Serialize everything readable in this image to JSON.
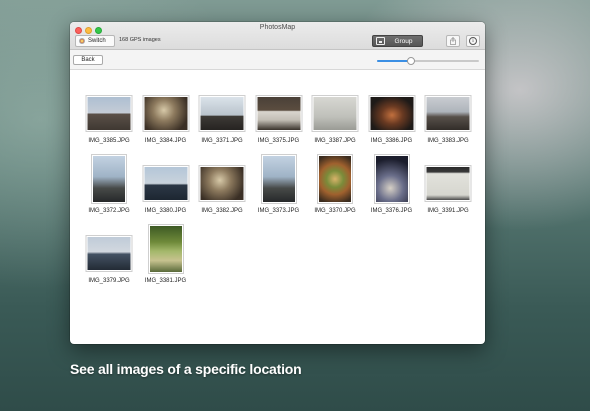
{
  "window": {
    "title": "PhotosMap",
    "switch_label": "Switch",
    "count_label": "168 GPS images",
    "group_label": "Group",
    "back_label": "Back",
    "share_icon": "share-icon",
    "info_icon": "info-icon",
    "info_glyph": "i",
    "zoom_fraction": 0.33
  },
  "photos": [
    {
      "name": "IMG_3385.JPG",
      "style": "p-skyline",
      "orientation": "landscape"
    },
    {
      "name": "IMG_3384.JPG",
      "style": "p-indoor",
      "orientation": "landscape"
    },
    {
      "name": "IMG_3371.JPG",
      "style": "p-tower",
      "orientation": "landscape"
    },
    {
      "name": "IMG_3375.JPG",
      "style": "p-desk",
      "orientation": "landscape"
    },
    {
      "name": "IMG_3387.JPG",
      "style": "p-screen",
      "orientation": "landscape"
    },
    {
      "name": "IMG_3386.JPG",
      "style": "p-night",
      "orientation": "landscape"
    },
    {
      "name": "IMG_3383.JPG",
      "style": "p-room",
      "orientation": "landscape"
    },
    {
      "name": "IMG_3372.JPG",
      "style": "p-tall",
      "orientation": "portrait"
    },
    {
      "name": "IMG_3380.JPG",
      "style": "p-water",
      "orientation": "landscape"
    },
    {
      "name": "IMG_3382.JPG",
      "style": "p-indoor",
      "orientation": "landscape"
    },
    {
      "name": "IMG_3373.JPG",
      "style": "p-tall",
      "orientation": "portrait"
    },
    {
      "name": "IMG_3370.JPG",
      "style": "p-food",
      "orientation": "portrait"
    },
    {
      "name": "IMG_3376.JPG",
      "style": "p-dark",
      "orientation": "portrait"
    },
    {
      "name": "IMG_3391.JPG",
      "style": "p-paper",
      "orientation": "landscape"
    },
    {
      "name": "IMG_3379.JPG",
      "style": "p-lake",
      "orientation": "landscape"
    },
    {
      "name": "IMG_3381.JPG",
      "style": "p-garden",
      "orientation": "portrait"
    }
  ],
  "tagline": "See all images of a specific location",
  "colors": {
    "accent": "#3b8fe4",
    "group_button": "#5e5e5e"
  }
}
